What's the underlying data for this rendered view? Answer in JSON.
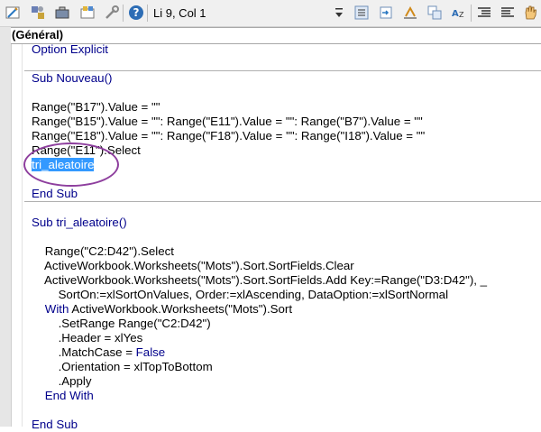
{
  "toolbar": {
    "position_text": "Li 9, Col 1",
    "icons": [
      "design-mode-icon",
      "vbaproject-icon",
      "toolbox-icon",
      "userform-icon",
      "tools-icon",
      "help-icon",
      "indent-icon",
      "outdent-icon",
      "bookmark-icon",
      "toggle-breakpoint-icon",
      "complete-word-icon",
      "comment-block-icon",
      "uncomment-block-icon",
      "hand-icon"
    ]
  },
  "code_window": {
    "selector_label": "(Général)"
  },
  "code": {
    "option": "Option Explicit",
    "sub1_header": "Sub Nouveau()",
    "l_b17": "Range(\"B17\").Value = \"\"",
    "l_b15": "Range(\"B15\").Value = \"\": Range(\"E11\").Value = \"\": Range(\"B7\").Value = \"\"",
    "l_e18": "Range(\"E18\").Value = \"\": Range(\"F18\").Value = \"\": Range(\"I18\").Value = \"\"",
    "l_select": "Range(\"E11\").Select",
    "l_call": "tri_aleatoire",
    "sub1_end": "End Sub",
    "sub2_header": "Sub tri_aleatoire()",
    "l_c2": "Range(\"C2:D42\").Select",
    "l_clear": "ActiveWorkbook.Worksheets(\"Mots\").Sort.SortFields.Clear",
    "l_add": "ActiveWorkbook.Worksheets(\"Mots\").Sort.SortFields.Add Key:=Range(\"D3:D42\"), _",
    "l_sorton": "SortOn:=xlSortOnValues, Order:=xlAscending, DataOption:=xlSortNormal",
    "with_kw": "With",
    "with_rest": " ActiveWorkbook.Worksheets(\"Mots\").Sort",
    "l_setrange": ".SetRange Range(\"C2:D42\")",
    "l_header": ".Header = xlYes",
    "l_matchcase_a": ".MatchCase = ",
    "l_matchcase_b": "False",
    "l_orientation": ".Orientation = xlTopToBottom",
    "l_apply": ".Apply",
    "endwith": "End With",
    "sub2_end": "End Sub"
  },
  "colors": {
    "keyword": "#00008b",
    "selection": "#3399ff",
    "annotation_ellipse": "#8e3f9e"
  }
}
